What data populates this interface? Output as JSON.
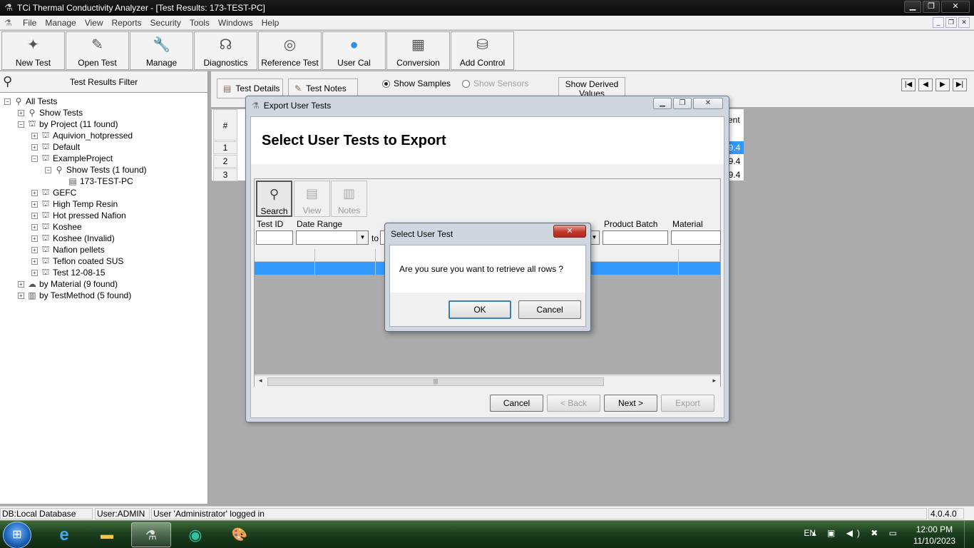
{
  "window": {
    "title": "TCi Thermal Conductivity Analyzer - [Test Results: 173-TEST-PC]",
    "controls": [
      "▁",
      "❐",
      "✕"
    ]
  },
  "menu": {
    "items": [
      "File",
      "Manage",
      "View",
      "Reports",
      "Security",
      "Tools",
      "Windows",
      "Help"
    ],
    "mdi_controls": [
      "_",
      "❐",
      "✕"
    ]
  },
  "toolbar": {
    "buttons": [
      {
        "label": "New Test",
        "icon": "new-test-icon"
      },
      {
        "label": "Open Test",
        "icon": "open-test-icon"
      },
      {
        "label": "Manage",
        "icon": "wrench-icon"
      },
      {
        "label": "Diagnostics",
        "icon": "stethoscope-icon"
      },
      {
        "label": "Reference Test",
        "icon": "target-icon"
      },
      {
        "label": "User Cal",
        "icon": "user-icon"
      },
      {
        "label": "Conversion",
        "icon": "calculator-icon"
      },
      {
        "label": "Add Control",
        "icon": "cylinder-icon"
      }
    ]
  },
  "sidebar": {
    "header": "Test Results Filter",
    "tree": [
      {
        "label": "All Tests",
        "level": 0,
        "exp": "−",
        "icon": "magnifier-icon"
      },
      {
        "label": "Show Tests",
        "level": 1,
        "exp": "+",
        "icon": "magnifier-icon"
      },
      {
        "label": "by Project (11 found)",
        "level": 1,
        "exp": "−",
        "icon": "project-icon"
      },
      {
        "label": "Aquivion_hotpressed",
        "level": 2,
        "exp": "+",
        "icon": "project-icon"
      },
      {
        "label": "Default",
        "level": 2,
        "exp": "+",
        "icon": "project-icon"
      },
      {
        "label": "ExampleProject",
        "level": 2,
        "exp": "−",
        "icon": "project-icon"
      },
      {
        "label": "Show Tests (1 found)",
        "level": 3,
        "exp": "−",
        "icon": "magnifier-icon"
      },
      {
        "label": "173-TEST-PC",
        "level": 4,
        "exp": "",
        "icon": "test-document-icon"
      },
      {
        "label": "GEFC",
        "level": 2,
        "exp": "+",
        "icon": "project-icon"
      },
      {
        "label": "High Temp Resin",
        "level": 2,
        "exp": "+",
        "icon": "project-icon"
      },
      {
        "label": "Hot pressed Nafion",
        "level": 2,
        "exp": "+",
        "icon": "project-icon"
      },
      {
        "label": "Koshee",
        "level": 2,
        "exp": "+",
        "icon": "project-icon"
      },
      {
        "label": "Koshee (Invalid)",
        "level": 2,
        "exp": "+",
        "icon": "project-icon"
      },
      {
        "label": "Nafion pellets",
        "level": 2,
        "exp": "+",
        "icon": "project-icon"
      },
      {
        "label": "Teflon coated SUS",
        "level": 2,
        "exp": "+",
        "icon": "project-icon"
      },
      {
        "label": "Test 12-08-15",
        "level": 2,
        "exp": "+",
        "icon": "project-icon"
      },
      {
        "label": "by Material (9 found)",
        "level": 1,
        "exp": "+",
        "icon": "material-icon"
      },
      {
        "label": "by TestMethod (5 found)",
        "level": 1,
        "exp": "+",
        "icon": "test-method-icon"
      }
    ]
  },
  "results": {
    "tabs": [
      "Test Details",
      "Test Notes"
    ],
    "radios": [
      {
        "label": "Show Samples",
        "checked": true,
        "enabled": true
      },
      {
        "label": "Show Sensors",
        "checked": false,
        "enabled": false
      }
    ],
    "derived_button": "Show Derived Values",
    "grid_header": "#",
    "row_numbers": [
      "1",
      "2",
      "3"
    ],
    "extra_column_header": "ent",
    "extra_values": [
      "9.4",
      "9.4",
      "9.4"
    ]
  },
  "export_dialog": {
    "title": "Export User Tests",
    "heading": "Select User Tests to Export",
    "tools": [
      {
        "label": "Search",
        "icon": "magnifier-icon",
        "enabled": true
      },
      {
        "label": "View",
        "icon": "view-document-icon",
        "enabled": false
      },
      {
        "label": "Notes",
        "icon": "notes-icon",
        "enabled": false
      }
    ],
    "filters": {
      "test_id_label": "Test ID",
      "date_range_label": "Date Range",
      "to_label": "to",
      "product_batch_label": "Product Batch",
      "material_label": "Material"
    },
    "buttons": {
      "cancel": "Cancel",
      "back": "< Back",
      "next": "Next >",
      "export": "Export"
    }
  },
  "confirm_dialog": {
    "title": "Select User Test",
    "message": "Are you sure you want to retrieve all rows ?",
    "ok": "OK",
    "cancel": "Cancel"
  },
  "status": {
    "db": "DB:Local Database TCi",
    "user": "User:ADMIN",
    "message": "User 'Administrator' logged in",
    "version": "4.0.4.0"
  },
  "taskbar": {
    "apps": [
      {
        "name": "internet-explorer",
        "active": false
      },
      {
        "name": "file-explorer",
        "active": false
      },
      {
        "name": "tci-analyzer",
        "active": true
      },
      {
        "name": "edge",
        "active": false
      },
      {
        "name": "paint",
        "active": false
      }
    ],
    "language": "EN",
    "time": "12:00 PM",
    "date": "11/10/2023"
  },
  "colors": {
    "selection": "#3399ff",
    "taskbar": "#1c3f1e",
    "titlebar": "#0a0a0a"
  }
}
